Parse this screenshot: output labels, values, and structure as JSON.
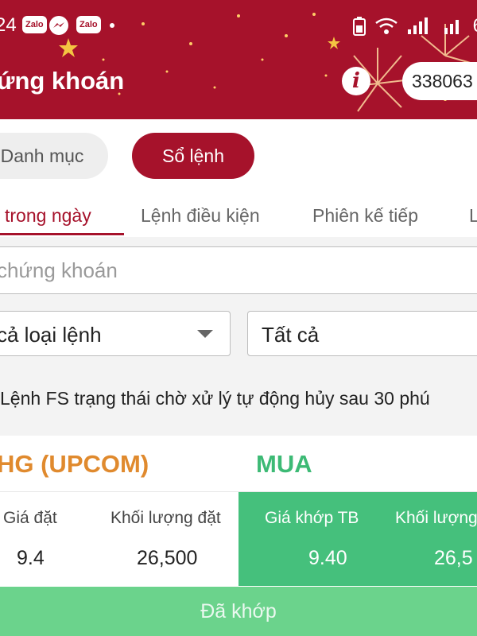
{
  "statusbar": {
    "time": "24",
    "apps": [
      "Zalo",
      "Zalo"
    ],
    "battery_pct": "6"
  },
  "header": {
    "title": "ứng khoán",
    "info_glyph": "i",
    "account_number": "338063"
  },
  "segments": {
    "danh_muc": "Danh mục",
    "so_lenh": "Sổ lệnh"
  },
  "tabs": [
    {
      "label": "trong ngày",
      "active": true
    },
    {
      "label": "Lệnh điều kiện",
      "active": false
    },
    {
      "label": "Phiên kế tiếp",
      "active": false
    },
    {
      "label": "L",
      "active": false
    }
  ],
  "search": {
    "placeholder": "chứng khoán"
  },
  "filters": {
    "order_type": "cả loại lệnh",
    "status": "Tất cả"
  },
  "notice": "Lệnh FS trạng thái chờ xử lý tự động hủy sau 30 phú",
  "order": {
    "symbol": "HG (UPCOM)",
    "side": "MUA",
    "columns": [
      {
        "label": "Giá đặt",
        "value": "9.4"
      },
      {
        "label": "Khối lượng đặt",
        "value": "26,500"
      },
      {
        "label": "Giá khớp TB",
        "value": "9.40"
      },
      {
        "label": "Khối lượng",
        "value": "26,5"
      }
    ],
    "status": "Đã khớp"
  },
  "colors": {
    "brand": "#a6122b",
    "buy": "#3dba75",
    "symbol": "#e08a2e",
    "matched_panel": "#45c07c",
    "matched_bar": "#6bd38c"
  }
}
